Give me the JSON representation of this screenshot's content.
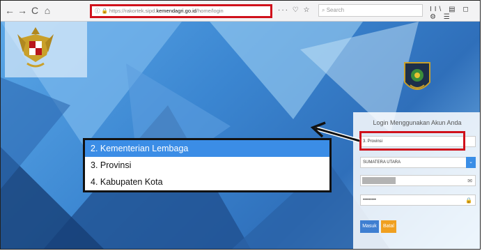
{
  "browser": {
    "url_prefix": "https://rakortek.sipd.",
    "url_domain": "kemendagri.go.id",
    "url_path": "/home/login",
    "search_placeholder": "Search",
    "nav_back": "←",
    "nav_forward": "→",
    "nav_reload": "C",
    "nav_home": "⌂",
    "toolbar_mid_icons": "··· ♡ ☆",
    "toolbar_right_icons": "II\\ ▤ ◻ ⚙ ☰"
  },
  "login": {
    "title": "Login Menggunakan Akun Anda",
    "level_value": "3. Provinsi",
    "province_value": "SUMATERA UTARA",
    "password_mask": "•••••••••",
    "masuk_label": "Masuk",
    "batal_label": "Batal"
  },
  "dropdown": {
    "options": [
      {
        "label": "2. Kementerian Lembaga",
        "selected": true
      },
      {
        "label": "3. Provinsi",
        "selected": false
      },
      {
        "label": "4. Kabupaten Kota",
        "selected": false
      }
    ]
  },
  "colors": {
    "highlight": "#d0111b",
    "selected": "#3b8de6",
    "masuk": "#3f7fd1",
    "batal": "#f0a020"
  }
}
